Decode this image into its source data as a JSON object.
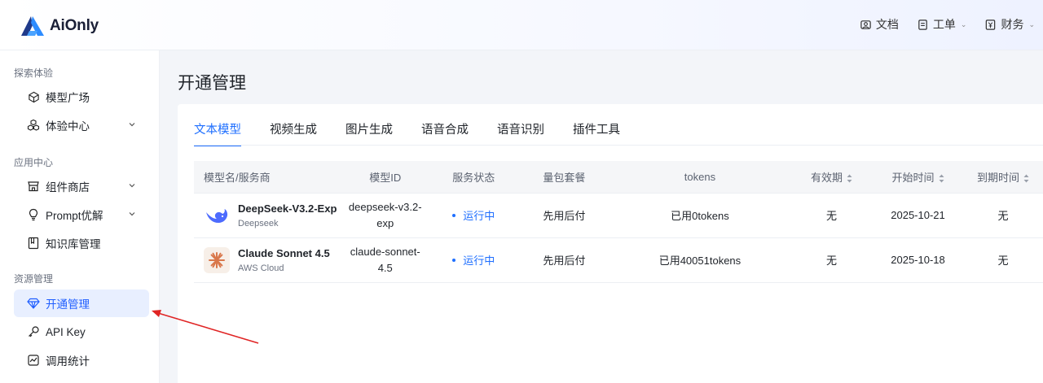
{
  "header": {
    "brand": "AiOnly",
    "nav": [
      {
        "label": "文档",
        "icon": "docs-icon"
      },
      {
        "label": "工单",
        "icon": "ticket-icon"
      },
      {
        "label": "财务",
        "icon": "finance-icon"
      }
    ]
  },
  "sidebar": {
    "groups": [
      {
        "title": "探索体验",
        "items": [
          {
            "label": "模型广场",
            "icon": "cube-icon"
          },
          {
            "label": "体验中心",
            "icon": "cubes-icon"
          }
        ]
      },
      {
        "title": "应用中心",
        "items": [
          {
            "label": "组件商店",
            "icon": "store-icon"
          },
          {
            "label": "Prompt优解",
            "icon": "bulb-icon"
          },
          {
            "label": "知识库管理",
            "icon": "book-icon"
          }
        ]
      },
      {
        "title": "资源管理",
        "items": [
          {
            "label": "开通管理",
            "icon": "diamond-icon"
          },
          {
            "label": "API Key",
            "icon": "key-icon"
          },
          {
            "label": "调用统计",
            "icon": "chart-icon"
          }
        ]
      }
    ]
  },
  "main": {
    "title": "开通管理",
    "tabs": [
      "文本模型",
      "视频生成",
      "图片生成",
      "语音合成",
      "语音识别",
      "插件工具"
    ],
    "table": {
      "columns": [
        "模型名/服务商",
        "模型ID",
        "服务状态",
        "量包套餐",
        "tokens",
        "有效期",
        "开始时间",
        "到期时间"
      ],
      "rows": [
        {
          "name": "DeepSeek-V3.2-Exp",
          "vendor": "Deepseek",
          "id_line1": "deepseek-v3.2-",
          "id_line2": "exp",
          "status": "运行中",
          "package": "先用后付",
          "tokens": "已用0tokens",
          "validity": "无",
          "start": "2025-10-21",
          "end": "无"
        },
        {
          "name": "Claude Sonnet 4.5",
          "vendor": "AWS Cloud",
          "id_line1": "claude-sonnet-",
          "id_line2": "4.5",
          "status": "运行中",
          "package": "先用后付",
          "tokens": "已用40051tokens",
          "validity": "无",
          "start": "2025-10-18",
          "end": "无"
        }
      ]
    }
  },
  "colors": {
    "accent": "#1f6fff",
    "active_bg": "#e8efff",
    "annotation_arrow": "#e02424"
  }
}
